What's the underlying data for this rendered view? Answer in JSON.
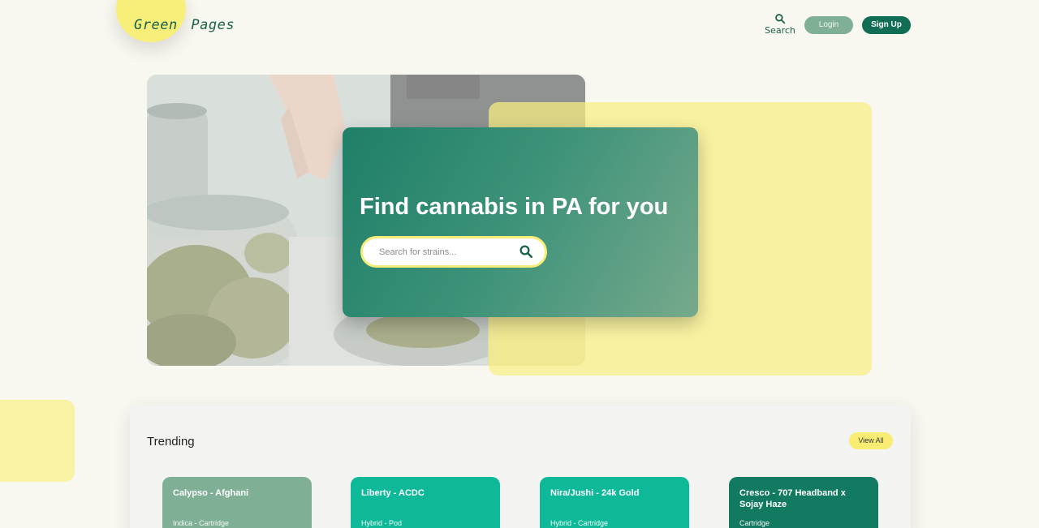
{
  "header": {
    "logo": "Green Pages",
    "search_label": "Search",
    "login_label": "Login",
    "signup_label": "Sign Up"
  },
  "hero": {
    "title": "Find cannabis in PA for you",
    "search_placeholder": "Search for strains..."
  },
  "trending": {
    "title": "Trending",
    "view_all_label": "View All",
    "items": [
      {
        "name": "Calypso - Afghani",
        "meta": "Indica - Cartridge",
        "color": "#7fb095"
      },
      {
        "name": "Liberty - ACDC",
        "meta": "Hybrid - Pod",
        "color": "#0eb99a"
      },
      {
        "name": "Nira/Jushi - 24k Gold",
        "meta": "Hybrid - Cartridge",
        "color": "#0eb99a"
      },
      {
        "name": "Cresco - 707 Headband x Sojay Haze",
        "meta": "Cartridge",
        "color": "#117a60"
      }
    ]
  },
  "colors": {
    "brand_dark": "#116e55",
    "brand_light": "#7fb095",
    "accent_yellow": "#f8ec72",
    "background": "#f8f7f0"
  }
}
